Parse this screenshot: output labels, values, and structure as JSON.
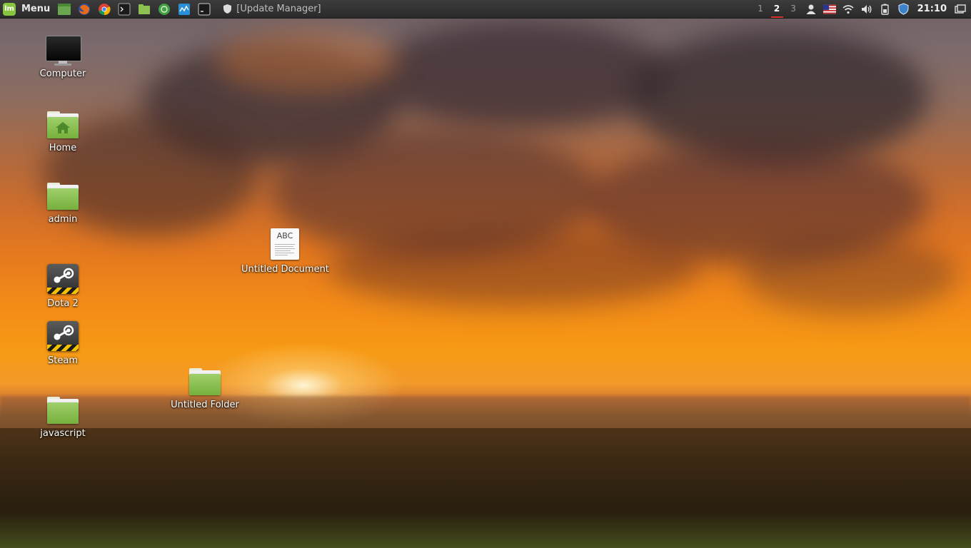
{
  "panel": {
    "menu_label": "Menu",
    "window_title": "[Update Manager]",
    "launchers": [
      "show-desktop",
      "firefox",
      "chrome",
      "terminal",
      "files",
      "network",
      "system-monitor",
      "terminal-2"
    ],
    "workspaces": [
      "1",
      "2",
      "3"
    ],
    "active_workspace": "2",
    "clock": "21:10"
  },
  "desktop": {
    "icons": [
      {
        "label": "Computer",
        "type": "computer"
      },
      {
        "label": "Home",
        "type": "home-folder"
      },
      {
        "label": "admin",
        "type": "folder"
      },
      {
        "label": "Dota 2",
        "type": "steam-app"
      },
      {
        "label": "Steam",
        "type": "steam-app"
      },
      {
        "label": "javascript",
        "type": "folder"
      },
      {
        "label": "Untitled Document",
        "type": "text-document",
        "glyph_text": "ABC"
      },
      {
        "label": "Untitled Folder",
        "type": "folder"
      }
    ]
  },
  "colors": {
    "panel_bg": "#2f2f2f",
    "folder_green": "#8cc152",
    "mint_green": "#87c541",
    "active_workspace_underline": "#d9342b"
  }
}
